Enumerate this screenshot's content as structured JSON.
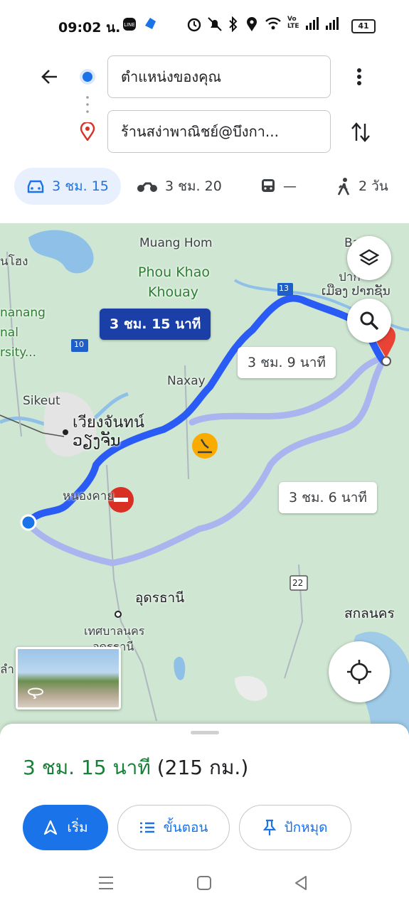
{
  "status_bar": {
    "time": "09:02 น.",
    "battery": "41",
    "indicators": [
      "line-icon",
      "messenger-icon",
      "alarm-icon",
      "mute-icon",
      "bluetooth-icon",
      "location-icon",
      "wifi-icon",
      "volte-icon",
      "signal-icon"
    ]
  },
  "directions": {
    "origin": "ตำแหน่งของคุณ",
    "destination": "ร้านสง่าพาณิชย์@บึงกา..."
  },
  "modes": [
    {
      "name": "drive",
      "label": "3 ชม. 15",
      "icon": "car-icon",
      "active": true
    },
    {
      "name": "motorcycle",
      "label": "3 ชม. 20",
      "icon": "motorcycle-icon",
      "active": false
    },
    {
      "name": "transit",
      "label": "—",
      "icon": "train-icon",
      "active": false
    },
    {
      "name": "walk",
      "label": "2 วัน",
      "icon": "walk-icon",
      "active": false
    }
  ],
  "map": {
    "route_labels": {
      "selected": "3 ชม. 15 นาที",
      "alt1": "3 ชม. 9 นาที",
      "alt2": "3 ชม. 6 นาที"
    },
    "places": {
      "muang_hom": "Muang Hom",
      "phou_khao": "Phou Khao",
      "khouay": "Khouay",
      "naxay": "Naxay",
      "sikeut": "Sikeut",
      "vientiane_th": "เวียงจันทน์",
      "vientiane_lao": "ວຽງຈັນ",
      "nong_khai": "หนองคาย",
      "udon_thani": "อุดรธานี",
      "udon_muni": "เทศบาลนคร",
      "udon_muni2": "อุดรธานี",
      "sakon_nakhon": "สกลนคร",
      "nong_khai_edge": "นโฮง",
      "nanang": "nanang",
      "nal": "nal",
      "rsity": "rsity...",
      "bam": "Bam",
      "pak_th": "ปาก",
      "pak_lao": "ເມືອງ ປາກຊັນ",
      "lam": "ลำ"
    },
    "road_shields": [
      "13",
      "10",
      "22"
    ],
    "colors": {
      "selected_route": "#2a5cf5",
      "alt_route": "#aab4ee",
      "water": "#8fc1e8",
      "land": "#cfe7d2",
      "destination_pin": "#ea4335"
    }
  },
  "bottom_sheet": {
    "duration": "3 ชม. 15 นาที",
    "distance": "(215 กม.)",
    "buttons": {
      "start": "เริ่ม",
      "steps": "ขั้นตอน",
      "pin": "ปักหมุด"
    }
  },
  "nav_bar": [
    "menu-icon",
    "home-icon",
    "back-icon"
  ]
}
